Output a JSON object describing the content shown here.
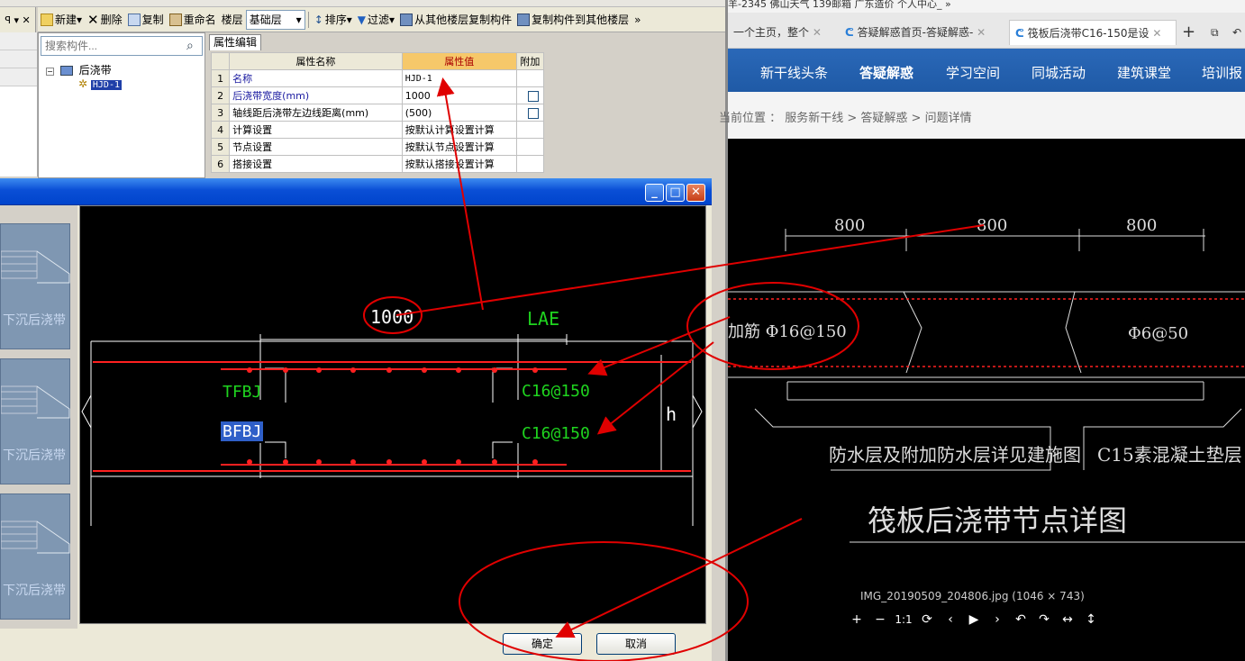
{
  "toolbar": {
    "new": "新建",
    "delete": "删除",
    "copy": "复制",
    "rename": "重命名",
    "floor": "楼层",
    "floor_value": "基础层",
    "sort": "排序",
    "filter": "过滤",
    "copy_from": "从其他楼层复制构件",
    "copy_to": "复制构件到其他楼层",
    "more": "»"
  },
  "tree": {
    "search_placeholder": "搜索构件...",
    "root": "后浇带",
    "child": "HJD-1"
  },
  "props": {
    "tab": "属性编辑",
    "headers": [
      "属性名称",
      "属性值",
      "附加"
    ],
    "rows": [
      {
        "n": "1",
        "name": "名称",
        "value": "HJD-1"
      },
      {
        "n": "2",
        "name": "后浇带宽度(mm)",
        "value": "1000"
      },
      {
        "n": "3",
        "name": "轴线距后浇带左边线距离(mm)",
        "value": "(500)"
      },
      {
        "n": "4",
        "name": "计算设置",
        "value": "按默认计算设置计算"
      },
      {
        "n": "5",
        "name": "节点设置",
        "value": "按默认节点设置计算"
      },
      {
        "n": "6",
        "name": "搭接设置",
        "value": "按默认搭接设置计算"
      }
    ]
  },
  "dialog": {
    "thumb_label": "下沉后浇带",
    "canvas": {
      "dim": "1000",
      "lae": "LAE",
      "tfbj": "TFBJ",
      "bfbj": "BFBJ",
      "c1": "C16@150",
      "c2": "C16@150",
      "h": "h"
    },
    "ok": "确定",
    "cancel": "取消"
  },
  "browser": {
    "bookmarks": "羊-2345    佛山天气    139邮箱    广东造价    个人中心_  »",
    "tabs": [
      {
        "title": "一个主页，整个"
      },
      {
        "title": "答疑解惑首页-答疑解惑-"
      },
      {
        "title": "筏板后浇带C16-150是设"
      }
    ],
    "nav": [
      "新干线头条",
      "答疑解惑",
      "学习空间",
      "同城活动",
      "建筑课堂",
      "培训报"
    ],
    "crumb": "当前位置 ： 服务新干线 > 答疑解惑 > 问题详情",
    "drawing": {
      "d1": "800",
      "d2": "800",
      "d3": "800",
      "rebar": "加筋 Φ16@150",
      "phi": "Φ6@50",
      "note1": "防水层及附加防水层详见建施图",
      "note2": "C15素混凝土垫层",
      "title": "筏板后浇带节点详图"
    },
    "caption": "IMG_20190509_204806.jpg (1046 × 743)",
    "controls": [
      "+",
      "−",
      "1:1",
      "⟳",
      "‹",
      "▶",
      "›",
      "↶",
      "↷",
      "↔",
      "↕"
    ]
  },
  "colors": {
    "annotation": "#e00000",
    "cad_green": "#1fd41f",
    "cad_red": "#ff2020",
    "titlebar": "#0a4fd6"
  }
}
